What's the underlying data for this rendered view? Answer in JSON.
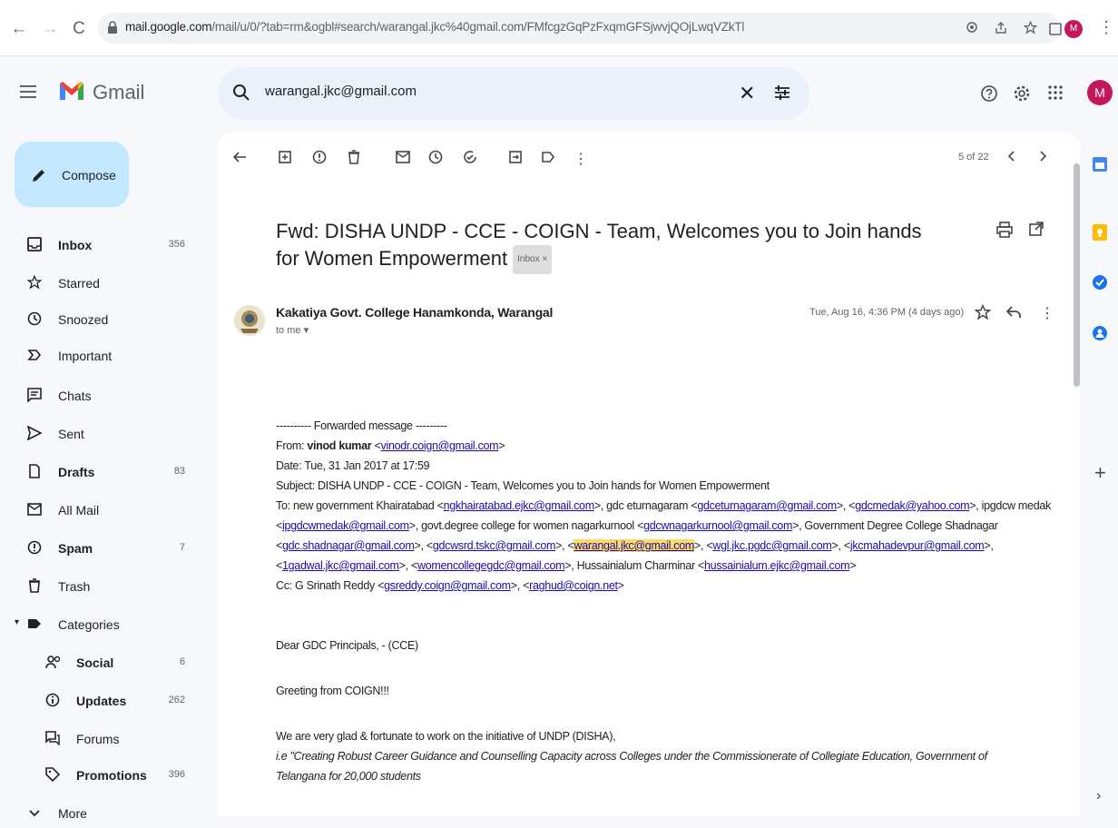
{
  "browser": {
    "url_host": "mail.google.com",
    "url_path": "/mail/u/0/?tab=rm&ogbl#search/warangal.jkc%40gmail.com/FMfcgzGqPzFxqmGFSjwvjQOjLwqVZkTl",
    "profile_initial": "M"
  },
  "app": {
    "name": "Gmail",
    "avatar_initial": "M"
  },
  "search": {
    "query": "warangal.jkc@gmail.com"
  },
  "compose": {
    "label": "Compose"
  },
  "sidebar": {
    "items": [
      {
        "label": "Inbox",
        "count": "356",
        "icon": "inbox-icon"
      },
      {
        "label": "Starred",
        "count": "",
        "icon": "star-icon"
      },
      {
        "label": "Snoozed",
        "count": "",
        "icon": "clock-icon"
      },
      {
        "label": "Important",
        "count": "",
        "icon": "important-icon"
      },
      {
        "label": "Chats",
        "count": "",
        "icon": "chat-icon"
      },
      {
        "label": "Sent",
        "count": "",
        "icon": "send-icon"
      },
      {
        "label": "Drafts",
        "count": "83",
        "icon": "draft-icon"
      },
      {
        "label": "All Mail",
        "count": "",
        "icon": "mail-icon"
      },
      {
        "label": "Spam",
        "count": "7",
        "icon": "spam-icon"
      },
      {
        "label": "Trash",
        "count": "",
        "icon": "trash-icon"
      },
      {
        "label": "Categories",
        "count": "",
        "icon": "label-icon"
      },
      {
        "label": "Social",
        "count": "6",
        "icon": "people-icon"
      },
      {
        "label": "Updates",
        "count": "262",
        "icon": "info-icon"
      },
      {
        "label": "Forums",
        "count": "",
        "icon": "forum-icon"
      },
      {
        "label": "Promotions",
        "count": "396",
        "icon": "tag-icon"
      },
      {
        "label": "More",
        "count": "",
        "icon": "chevron-down-icon"
      }
    ]
  },
  "toolbar": {
    "pager": "5 of 22"
  },
  "email": {
    "subject": "Fwd: DISHA UNDP - CCE - COIGN - Team, Welcomes you to Join hands for Women Empowerment",
    "label_chip": "Inbox ×",
    "sender": "Kakatiya Govt. College Hanamkonda, Warangal",
    "to": "to me ▾",
    "date": "Tue, Aug 16, 4:36 PM (4 days ago)",
    "body": {
      "fwd_header": "---------- Forwarded message ---------",
      "from_label": "From: ",
      "from_name": "vinod kumar",
      "from_email": "vinodr.coign@gmail.com",
      "date_line": "Date: Tue, 31 Jan 2017 at 17:59",
      "subject_line": "Subject: DISHA UNDP - CCE - COIGN - Team, Welcomes you to Join hands for Women Empowerment",
      "to_1a": "To: new government Khairatabad <",
      "to_1_e1": "ngkhairatabad.ejkc@gmail.com",
      "to_1b": ">, gdc eturnagaram <",
      "to_1_e2": "gdceturnagaram@gmail.com",
      "to_1c": ">, <",
      "to_1_e3": "gdcmedak@yahoo.com",
      "to_1d": ">, ipgdcw medak",
      "to_2a": "<",
      "to_2_e1": "ipgdcwmedak@gmail.com",
      "to_2b": ">, govt.degree college for women nagarkurnool <",
      "to_2_e2": "gdcwnagarkurnool@gmail.com",
      "to_2c": ">, Government Degree College Shadnagar",
      "to_3a": "<",
      "to_3_e1": "gdc.shadnagar@gmail.com",
      "to_3b": ">, <",
      "to_3_e2": "gdcwsrd.tskc@gmail.com",
      "to_3c": ">, <",
      "to_3_e3": "warangal.jkc@gmail.com",
      "to_3d": ">, <",
      "to_3_e4": "wgl.jkc.pgdc@gmail.com",
      "to_3e": ">, <",
      "to_3_e5": "jkcmahadevpur@gmail.com",
      "to_3f": ">,",
      "to_4a": "<",
      "to_4_e1": "1gadwal.jkc@gmail.com",
      "to_4b": ">, <",
      "to_4_e2": "womencollegegdc@gmail.com",
      "to_4c": ">, Hussainialum Charminar <",
      "to_4_e3": "hussainialum.ejkc@gmail.com",
      "to_4d": ">",
      "cc_a": "Cc: G Srinath Reddy <",
      "cc_e1": "gsreddy.coign@gmail.com",
      "cc_b": ">, <",
      "cc_e2": "raghud@coign.net",
      "cc_c": ">",
      "greeting": "Dear GDC Principals, - (CCE)",
      "greeting2": "Greeting from COIGN!!!",
      "para1": "We are very glad & fortunate to work on the initiative of UNDP (DISHA),",
      "para2": "i.e \"Creating Robust Career Guidance and Counselling Capacity across Colleges under the Commissionerate of Collegiate Education, Government of",
      "para3": "Telangana for 20,000 students"
    }
  }
}
